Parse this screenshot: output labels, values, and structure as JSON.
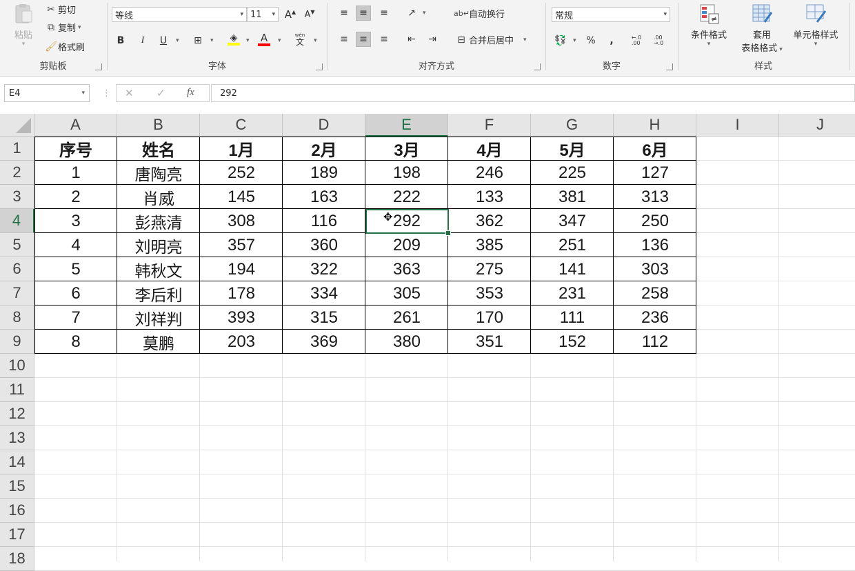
{
  "ribbon": {
    "clipboard": {
      "paste": "粘贴",
      "cut": "剪切",
      "copy": "复制",
      "format_painter": "格式刷",
      "label": "剪贴板"
    },
    "font": {
      "font_name": "等线",
      "font_size": "11",
      "grow": "A",
      "shrink": "A",
      "bold": "B",
      "italic": "I",
      "underline": "U",
      "pinyin": "wén",
      "pinyin_char": "文",
      "font_color_glyph": "A",
      "font_color": "#ff0000",
      "label": "字体"
    },
    "alignment": {
      "wrap_text": "自动换行",
      "merge_center": "合并后居中",
      "label": "对齐方式"
    },
    "number": {
      "format": "常规",
      "percent": "%",
      "comma": ",",
      "label": "数字"
    },
    "styles": {
      "conditional": "条件格式",
      "table_format_1": "套用",
      "table_format_2": "表格格式",
      "cell_styles": "单元格样式",
      "label": "样式"
    }
  },
  "formula_bar": {
    "name_box": "E4",
    "cancel": "✕",
    "enter": "✓",
    "fx": "fx",
    "value": "292"
  },
  "sheet": {
    "columns": [
      "A",
      "B",
      "C",
      "D",
      "E",
      "F",
      "G",
      "H",
      "I",
      "J"
    ],
    "rows": [
      "1",
      "2",
      "3",
      "4",
      "5",
      "6",
      "7",
      "8",
      "9",
      "10",
      "11",
      "12",
      "13",
      "14",
      "15",
      "16",
      "17",
      "18"
    ],
    "selected_cell": "E4",
    "header": [
      "序号",
      "姓名",
      "1月",
      "2月",
      "3月",
      "4月",
      "5月",
      "6月"
    ],
    "data": [
      [
        "1",
        "唐陶亮",
        "252",
        "189",
        "198",
        "246",
        "225",
        "127"
      ],
      [
        "2",
        "肖威",
        "145",
        "163",
        "222",
        "133",
        "381",
        "313"
      ],
      [
        "3",
        "彭燕清",
        "308",
        "116",
        "292",
        "362",
        "347",
        "250"
      ],
      [
        "4",
        "刘明亮",
        "357",
        "360",
        "209",
        "385",
        "251",
        "136"
      ],
      [
        "5",
        "韩秋文",
        "194",
        "322",
        "363",
        "275",
        "141",
        "303"
      ],
      [
        "6",
        "李后利",
        "178",
        "334",
        "305",
        "353",
        "231",
        "258"
      ],
      [
        "7",
        "刘祥判",
        "393",
        "315",
        "261",
        "170",
        "111",
        "236"
      ],
      [
        "8",
        "莫鹏",
        "203",
        "369",
        "380",
        "351",
        "152",
        "112"
      ]
    ]
  },
  "colors": {
    "accent": "#217346"
  }
}
